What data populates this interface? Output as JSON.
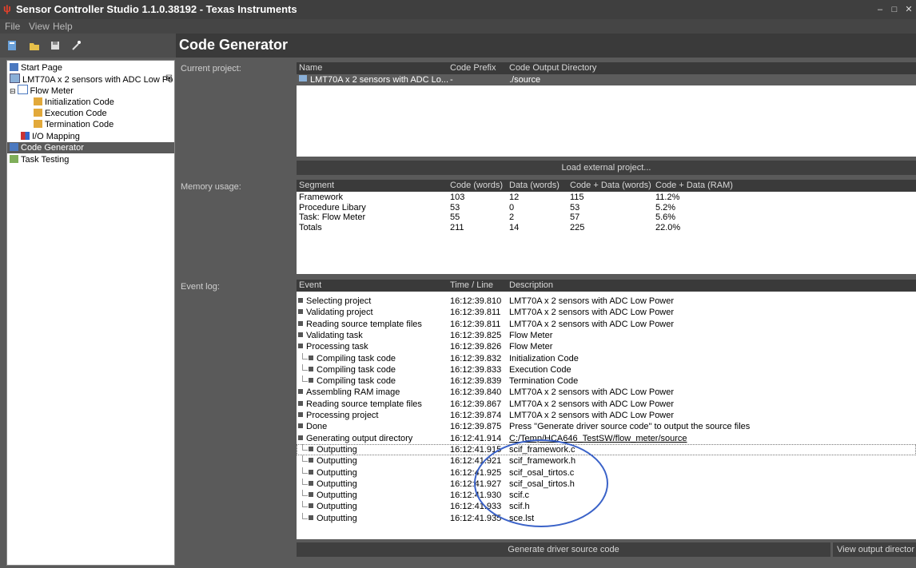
{
  "window": {
    "title": "Sensor Controller Studio 1.1.0.38192 - Texas Instruments"
  },
  "menu": {
    "file": "File",
    "view": "View",
    "help": "Help"
  },
  "page": {
    "title": "Code Generator"
  },
  "sidebar": {
    "items": [
      {
        "label": "Start Page"
      },
      {
        "label": "LMT70A x 2 sensors with ADC Low Po"
      },
      {
        "label": "Flow Meter"
      },
      {
        "label": "Initialization Code"
      },
      {
        "label": "Execution Code"
      },
      {
        "label": "Termination Code"
      },
      {
        "label": "I/O Mapping"
      },
      {
        "label": "Code Generator"
      },
      {
        "label": "Task Testing"
      }
    ]
  },
  "labels": {
    "current_project": "Current project:",
    "memory_usage": "Memory usage:",
    "event_log": "Event log:"
  },
  "project_table": {
    "headers": [
      "Name",
      "Code Prefix",
      "Code Output Directory"
    ],
    "row": {
      "name": "LMT70A x 2 sensors with ADC Lo...",
      "prefix": "-",
      "dir": "./source"
    }
  },
  "buttons": {
    "load_external": "Load external project...",
    "generate": "Generate driver source code",
    "view_output": "View output director"
  },
  "memory_table": {
    "headers": [
      "Segment",
      "Code (words)",
      "Data (words)",
      "Code + Data (words)",
      "Code + Data (RAM)"
    ],
    "rows": [
      {
        "segment": "Framework",
        "code": "103",
        "data": "12",
        "cd": "115",
        "ram": "11.2%"
      },
      {
        "segment": "Procedure Libary",
        "code": "53",
        "data": "0",
        "cd": "53",
        "ram": "5.2%"
      },
      {
        "segment": "Task: Flow Meter",
        "code": "55",
        "data": "2",
        "cd": "57",
        "ram": "5.6%"
      },
      {
        "segment": "Totals",
        "code": "211",
        "data": "14",
        "cd": "225",
        "ram": "22.0%"
      }
    ]
  },
  "event_table": {
    "headers": [
      "Event",
      "Time / Line",
      "Description"
    ],
    "rows": [
      {
        "event": "Selecting project",
        "time": "16:12:39.810",
        "desc": "LMT70A x 2 sensors with ADC Low Power"
      },
      {
        "event": "Validating project",
        "time": "16:12:39.811",
        "desc": "LMT70A x 2 sensors with ADC Low Power"
      },
      {
        "event": "Reading source template files",
        "time": "16:12:39.811",
        "desc": "LMT70A x 2 sensors with ADC Low Power"
      },
      {
        "event": "Validating task",
        "time": "16:12:39.825",
        "desc": "Flow Meter"
      },
      {
        "event": "Processing task",
        "time": "16:12:39.826",
        "desc": "Flow Meter"
      },
      {
        "event": "Compiling task code",
        "time": "16:12:39.832",
        "desc": "Initialization Code"
      },
      {
        "event": "Compiling task code",
        "time": "16:12:39.833",
        "desc": "Execution Code"
      },
      {
        "event": "Compiling task code",
        "time": "16:12:39.839",
        "desc": "Termination Code"
      },
      {
        "event": "Assembling RAM image",
        "time": "16:12:39.840",
        "desc": "LMT70A x 2 sensors with ADC Low Power"
      },
      {
        "event": "Reading source template files",
        "time": "16:12:39.867",
        "desc": "LMT70A x 2 sensors with ADC Low Power"
      },
      {
        "event": "Processing project",
        "time": "16:12:39.874",
        "desc": "LMT70A x 2 sensors with ADC Low Power"
      },
      {
        "event": "Done",
        "time": "16:12:39.875",
        "desc": "Press \"Generate driver source code\" to output the source files"
      },
      {
        "event": "Generating output directory",
        "time": "16:12:41.914",
        "desc": "C:/Temp/HCA646_TestSW/flow_meter/source"
      },
      {
        "event": "Outputting",
        "time": "16:12:41.915",
        "desc": "scif_framework.c"
      },
      {
        "event": "Outputting",
        "time": "16:12:41.921",
        "desc": "scif_framework.h"
      },
      {
        "event": "Outputting",
        "time": "16:12:41.925",
        "desc": "scif_osal_tirtos.c"
      },
      {
        "event": "Outputting",
        "time": "16:12:41.927",
        "desc": "scif_osal_tirtos.h"
      },
      {
        "event": "Outputting",
        "time": "16:12:41.930",
        "desc": "scif.c"
      },
      {
        "event": "Outputting",
        "time": "16:12:41.933",
        "desc": "scif.h"
      },
      {
        "event": "Outputting",
        "time": "16:12:41.935",
        "desc": "sce.lst"
      }
    ]
  },
  "colors": {
    "annotation_circle": "#3a62c8"
  }
}
